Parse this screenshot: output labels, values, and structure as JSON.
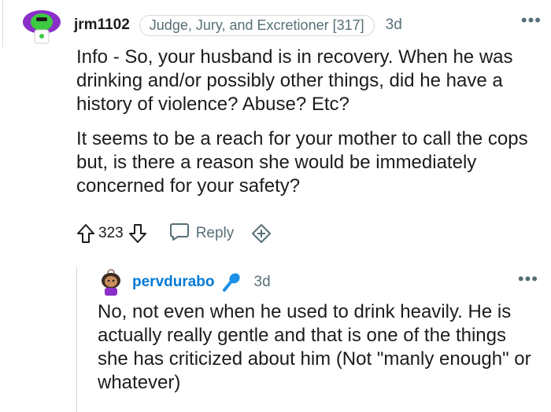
{
  "comment": {
    "username": "jrm1102",
    "flair": "Judge, Jury, and Excretioner [317]",
    "time": "3d",
    "paragraphs": [
      "Info - So, your husband is in recovery. When he was drinking and/or possibly other things, did he have a history of violence? Abuse? Etc?",
      "It seems to be a reach for your mother to call the cops but, is there a reason she would be immediately concerned for your safety?"
    ],
    "score": "323",
    "reply_label": "Reply"
  },
  "reply": {
    "username": "pervdurabo",
    "time": "3d",
    "paragraphs": [
      "No, not even when he used to drink heavily. He is actually really gentle and that is one of the things she has criticized about him (Not \"manly enough\" or whatever)"
    ]
  },
  "colors": {
    "op_username": "#1c1c1c",
    "reply_username": "#0079d3",
    "meta": "#576f76",
    "avatar_green": "#3ec943",
    "avatar_purple": "#8b2fc9"
  },
  "icons": [
    "upvote-icon",
    "downvote-icon",
    "reply-icon",
    "award-icon",
    "more-icon",
    "microphone-icon"
  ]
}
